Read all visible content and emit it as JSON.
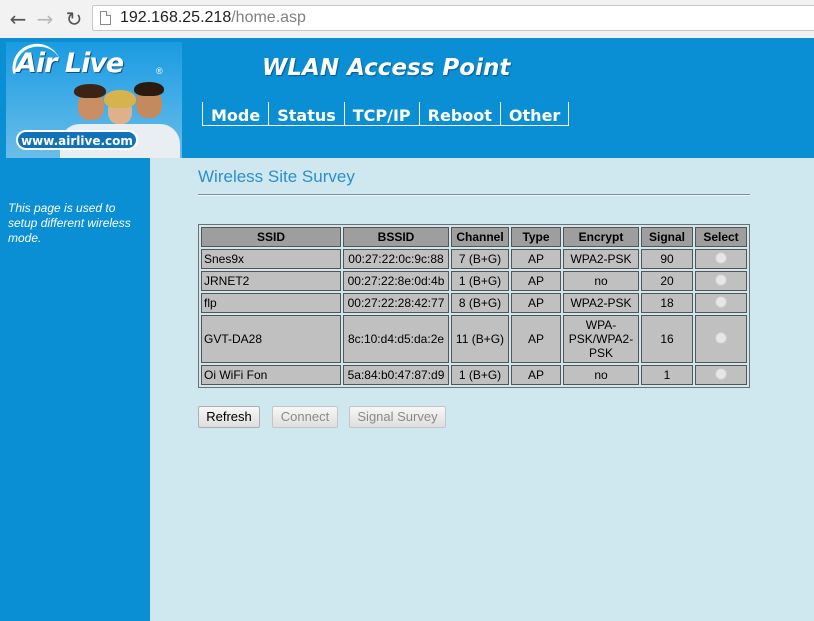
{
  "browser": {
    "url_host": "192.168.25.218",
    "url_path": "/home.asp"
  },
  "logo": {
    "brand": "Air Live",
    "registered": "®",
    "website": "www.airlive.com"
  },
  "header": {
    "title": "WLAN Access Point",
    "menu": [
      "Mode",
      "Status",
      "TCP/IP",
      "Reboot",
      "Other"
    ]
  },
  "sidebar": {
    "help_text": "This page is used to setup different wireless mode."
  },
  "main": {
    "heading": "Wireless Site Survey",
    "table": {
      "headers": [
        "SSID",
        "BSSID",
        "Channel",
        "Type",
        "Encrypt",
        "Signal",
        "Select"
      ],
      "rows": [
        {
          "ssid": "Snes9x",
          "bssid": "00:27:22:0c:9c:88",
          "channel": "7 (B+G)",
          "type": "AP",
          "encrypt": "WPA2-PSK",
          "signal": "90"
        },
        {
          "ssid": "JRNET2",
          "bssid": "00:27:22:8e:0d:4b",
          "channel": "1 (B+G)",
          "type": "AP",
          "encrypt": "no",
          "signal": "20"
        },
        {
          "ssid": "flp",
          "bssid": "00:27:22:28:42:77",
          "channel": "8 (B+G)",
          "type": "AP",
          "encrypt": "WPA2-PSK",
          "signal": "18"
        },
        {
          "ssid": "GVT-DA28",
          "bssid": "8c:10:d4:d5:da:2e",
          "channel": "11 (B+G)",
          "type": "AP",
          "encrypt": "WPA-PSK/WPA2-PSK",
          "signal": "16"
        },
        {
          "ssid": "Oi WiFi Fon",
          "bssid": "5a:84:b0:47:87:d9",
          "channel": "1 (B+G)",
          "type": "AP",
          "encrypt": "no",
          "signal": "1"
        }
      ]
    },
    "buttons": {
      "refresh": "Refresh",
      "connect": "Connect",
      "signal_survey": "Signal Survey"
    }
  },
  "colors": {
    "header_blue": "#0b8fd4",
    "content_bg": "#cfe8f0",
    "heading_blue": "#2a8fcc",
    "table_header": "#9e9e9e",
    "table_cell": "#c0c0c0"
  }
}
